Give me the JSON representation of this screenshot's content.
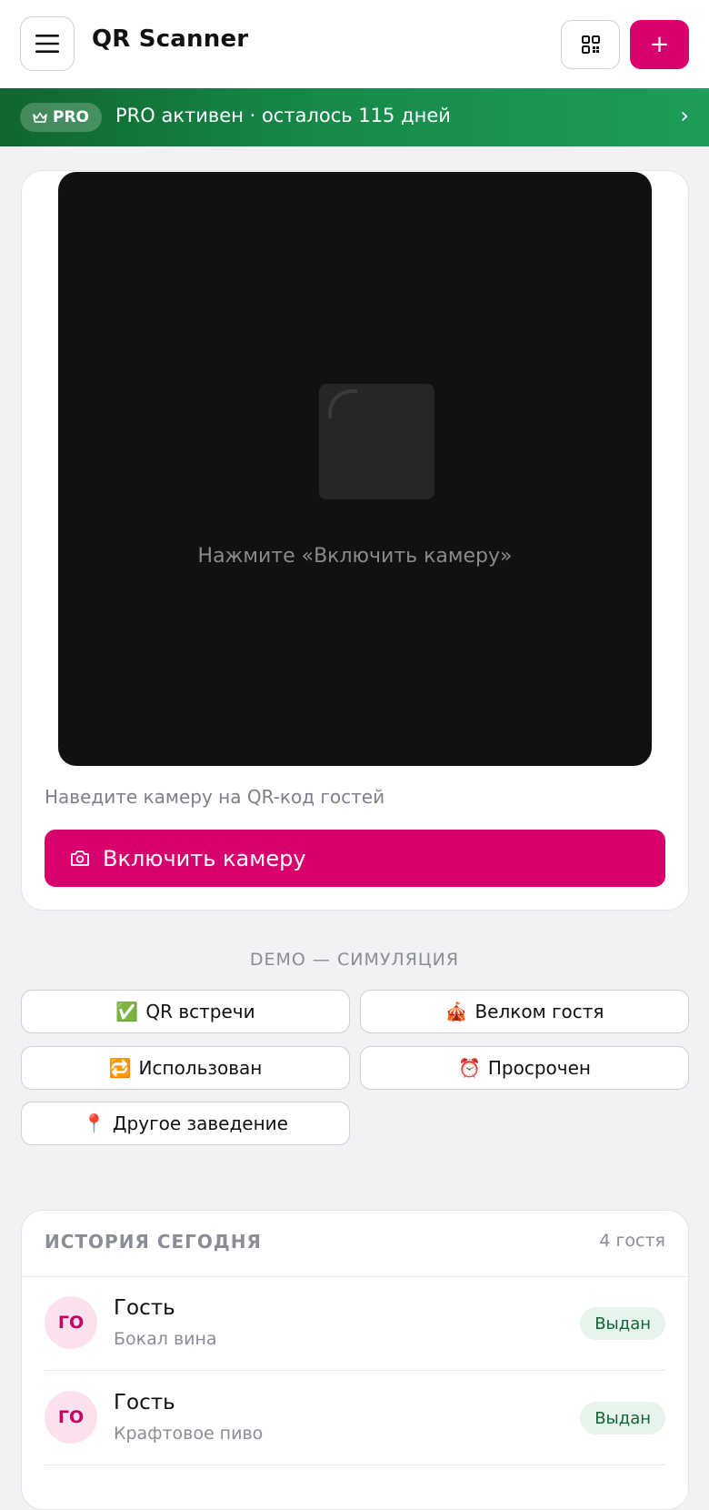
{
  "header": {
    "title": "QR Scanner",
    "menu_icon": "hamburger-icon",
    "qr_icon": "qr-code-icon",
    "add_label": "+"
  },
  "pro": {
    "badge": "PRO",
    "badge_icon": "crown-icon",
    "text": "PRO активен · осталось 115 дней",
    "chevron": "›",
    "color": "#17894a"
  },
  "scanner": {
    "camera_hint": "Нажмите «Включить камеру»",
    "tip": "Наведите камеру на QR-код гостей",
    "enable_button": "Включить камеру",
    "enable_icon": "camera-icon",
    "accent": "#d8006d"
  },
  "demo": {
    "title": "DEMO — СИМУЛЯЦИЯ",
    "buttons": [
      {
        "emoji": "✅",
        "label": "QR встречи"
      },
      {
        "emoji": "🎪",
        "label": "Велком гостя"
      },
      {
        "emoji": "🔁",
        "label": "Использован"
      },
      {
        "emoji": "⏰",
        "label": "Просрочен"
      },
      {
        "emoji": "📍",
        "label": "Другое заведение"
      }
    ]
  },
  "history": {
    "title": "ИСТОРИЯ СЕГОДНЯ",
    "count": "4 гостя",
    "rows": [
      {
        "initials": "ГО",
        "name": "Гость",
        "item": "Бокал вина",
        "status": "Выдан"
      },
      {
        "initials": "ГО",
        "name": "Гость",
        "item": "Крафтовое пиво",
        "status": "Выдан"
      }
    ]
  }
}
